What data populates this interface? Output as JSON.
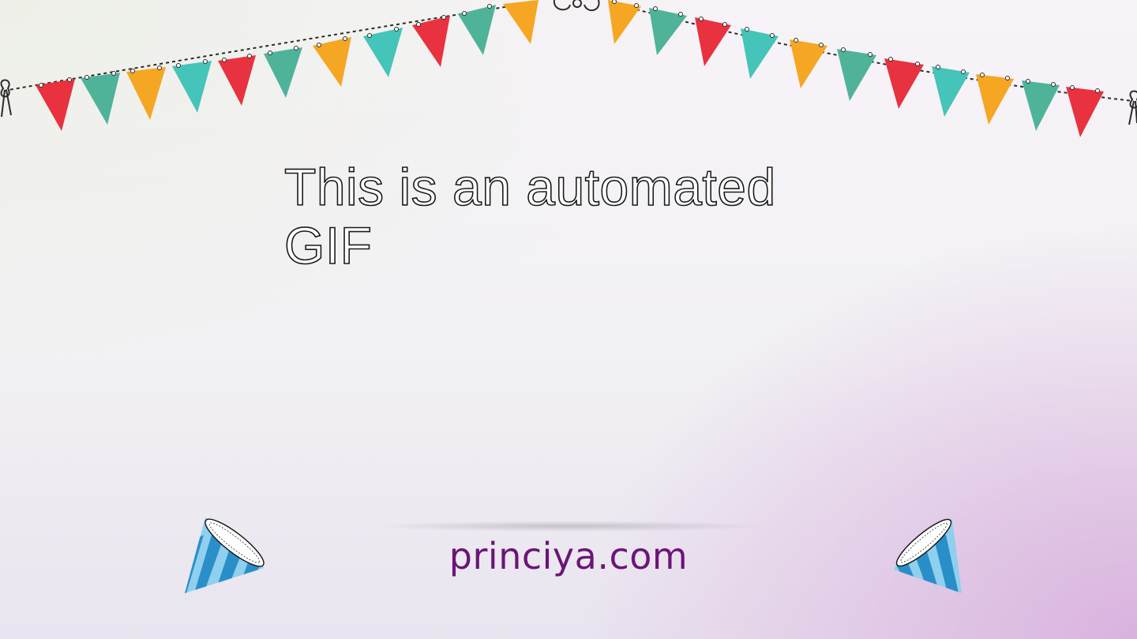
{
  "headline": "This is an automated GIF",
  "footer": {
    "site_link": "princiya.com"
  },
  "decorations": {
    "bunting_icon": "party-bunting-icon",
    "left_hat_icon": "party-hat-icon",
    "right_hat_icon": "party-hat-icon"
  },
  "colors": {
    "flag_red": "#e8323f",
    "flag_green": "#4fb39a",
    "flag_orange": "#f5a623",
    "flag_teal": "#45c4b9",
    "brand_purple": "#6b1577",
    "hat_blue": "#2a8fc8",
    "hat_light_blue": "#8fd0ee"
  }
}
